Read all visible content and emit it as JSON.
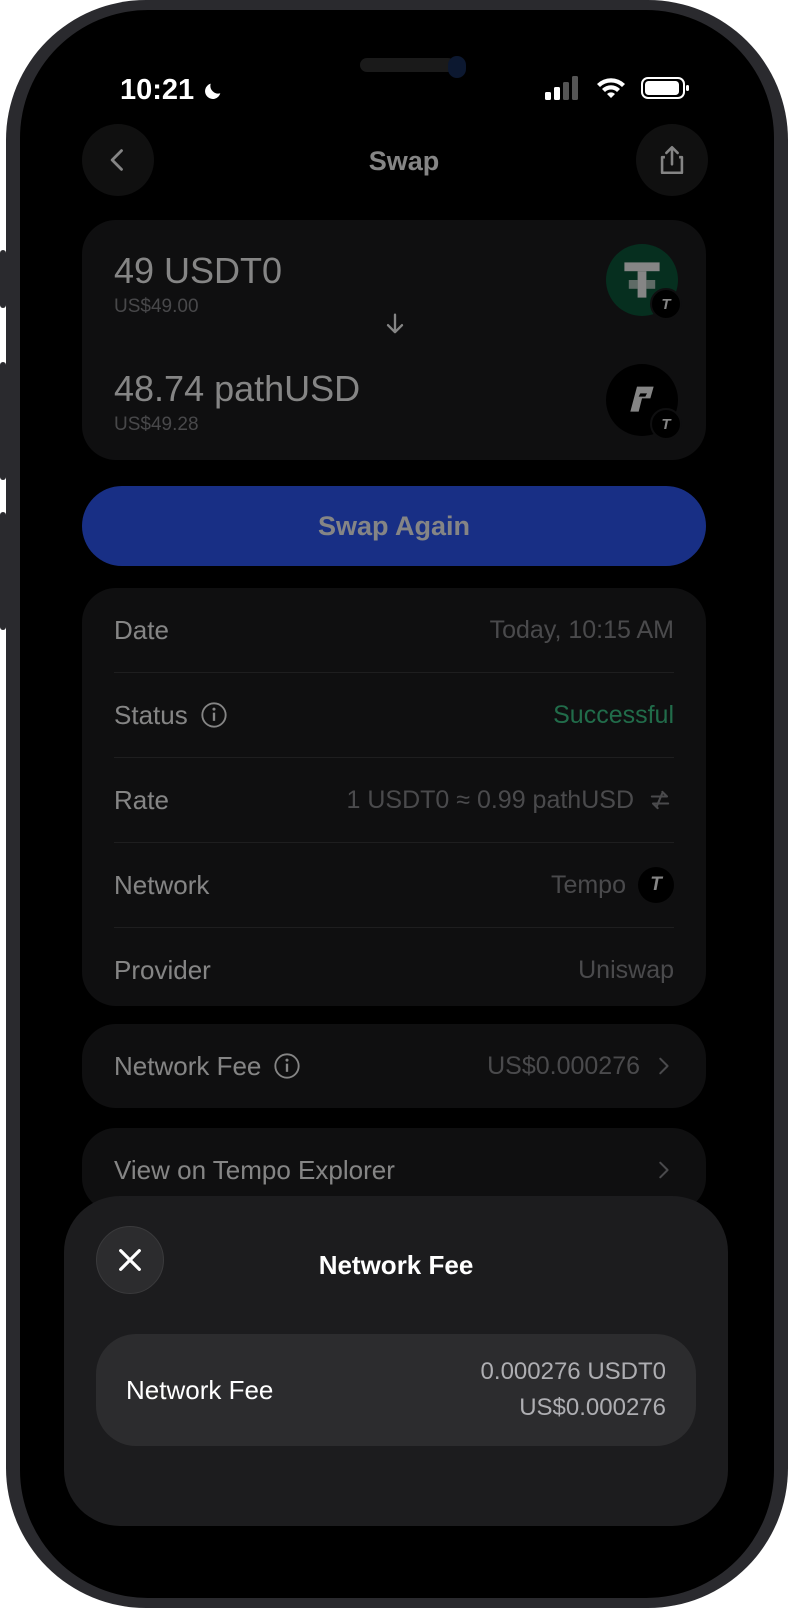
{
  "status_bar": {
    "time": "10:21"
  },
  "header": {
    "title": "Swap"
  },
  "swap": {
    "from": {
      "amount": "49 USDT0",
      "fiat": "US$49.00",
      "token_icon": "usdt0-token-icon",
      "token_color": "#0b5a3c"
    },
    "to": {
      "amount": "48.74 pathUSD",
      "fiat": "US$49.28",
      "token_icon": "pathusd-token-icon"
    },
    "network_badge_glyph": "T"
  },
  "swap_again_label": "Swap Again",
  "details": {
    "date_label": "Date",
    "date_value": "Today, 10:15 AM",
    "status_label": "Status",
    "status_value": "Successful",
    "status_color": "#3fcf8e",
    "rate_label": "Rate",
    "rate_value": "1 USDT0 ≈ 0.99 pathUSD",
    "network_label": "Network",
    "network_value": "Tempo",
    "provider_label": "Provider",
    "provider_value": "Uniswap"
  },
  "fee_row": {
    "label": "Network Fee",
    "value": "US$0.000276"
  },
  "explorer_row": {
    "label": "View on Tempo Explorer"
  },
  "sheet": {
    "title": "Network Fee",
    "label": "Network Fee",
    "token_value": "0.000276 USDT0",
    "fiat_value": "US$0.000276"
  },
  "colors": {
    "accent": "#2f5bff",
    "success": "#3fcf8e",
    "background": "#000000",
    "card": "#1c1c1e"
  }
}
